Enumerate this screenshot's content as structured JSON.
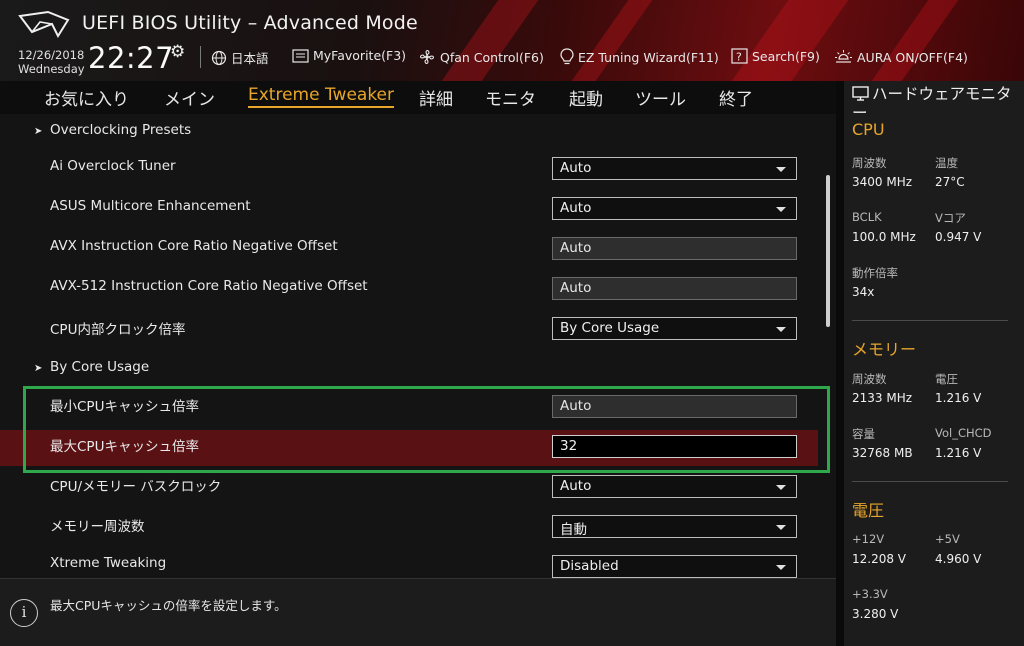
{
  "window": {
    "title": "UEFI BIOS Utility – Advanced Mode"
  },
  "header": {
    "date": "12/26/2018",
    "weekday": "Wednesday",
    "time": "22:27",
    "toolbar": [
      {
        "label": "日本語",
        "icon": "globe-icon"
      },
      {
        "label": "MyFavorite(F3)",
        "icon": "favorite-icon"
      },
      {
        "label": "Qfan Control(F6)",
        "icon": "fan-icon"
      },
      {
        "label": "EZ Tuning Wizard(F11)",
        "icon": "bulb-icon"
      },
      {
        "label": "Search(F9)",
        "icon": "help-search-icon"
      },
      {
        "label": "AURA ON/OFF(F4)",
        "icon": "aura-icon"
      }
    ]
  },
  "nav": {
    "tabs": [
      {
        "label": "お気に入り",
        "active": false
      },
      {
        "label": "メイン",
        "active": false
      },
      {
        "label": "Extreme Tweaker",
        "active": true
      },
      {
        "label": "詳細",
        "active": false
      },
      {
        "label": "モニタ",
        "active": false
      },
      {
        "label": "起動",
        "active": false
      },
      {
        "label": "ツール",
        "active": false
      },
      {
        "label": "終了",
        "active": false
      }
    ]
  },
  "main": {
    "rows": [
      {
        "type": "submenu",
        "label": "Overclocking Presets"
      },
      {
        "type": "select",
        "label": "Ai Overclock Tuner",
        "value": "Auto"
      },
      {
        "type": "select",
        "label": "ASUS Multicore Enhancement",
        "value": "Auto"
      },
      {
        "type": "readonly",
        "label": "AVX Instruction Core Ratio Negative Offset",
        "value": "Auto"
      },
      {
        "type": "readonly",
        "label": "AVX-512 Instruction Core Ratio Negative Offset",
        "value": "Auto"
      },
      {
        "type": "select",
        "label": "CPU内部クロック倍率",
        "value": "By Core Usage"
      },
      {
        "type": "submenu",
        "label": "By Core Usage"
      },
      {
        "type": "readonly",
        "label": "最小CPUキャッシュ倍率",
        "value": "Auto"
      },
      {
        "type": "input",
        "label": "最大CPUキャッシュ倍率",
        "value": "32"
      },
      {
        "type": "select",
        "label": "CPU/メモリー バスクロック",
        "value": "Auto"
      },
      {
        "type": "select",
        "label": "メモリー周波数",
        "value": "自動"
      },
      {
        "type": "select",
        "label": "Xtreme Tweaking",
        "value": "Disabled"
      }
    ]
  },
  "help": {
    "text": "最大CPUキャッシュの倍率を設定します。"
  },
  "hardware_monitor": {
    "title": "ハードウェアモニター",
    "cpu": {
      "heading": "CPU",
      "freq_label": "周波数",
      "freq_value": "3400 MHz",
      "temp_label": "温度",
      "temp_value": "27°C",
      "bclk_label": "BCLK",
      "bclk_value": "100.0 MHz",
      "vcore_label": "Vコア",
      "vcore_value": "0.947 V",
      "ratio_label": "動作倍率",
      "ratio_value": "34x"
    },
    "memory": {
      "heading": "メモリー",
      "freq_label": "周波数",
      "freq_value": "2133 MHz",
      "volt_label": "電圧",
      "volt_value": "1.216 V",
      "cap_label": "容量",
      "cap_value": "32768 MB",
      "vol_chcd_label": "Vol_CHCD",
      "vol_chcd_value": "1.216 V"
    },
    "voltage": {
      "heading": "電圧",
      "v12_label": "+12V",
      "v12_value": "12.208 V",
      "v5_label": "+5V",
      "v5_value": "4.960 V",
      "v33_label": "+3.3V",
      "v33_value": "3.280 V"
    }
  },
  "colors": {
    "accent": "#e7a52b",
    "highlight": "#5a1114",
    "selection_outline": "#2ea84a"
  }
}
